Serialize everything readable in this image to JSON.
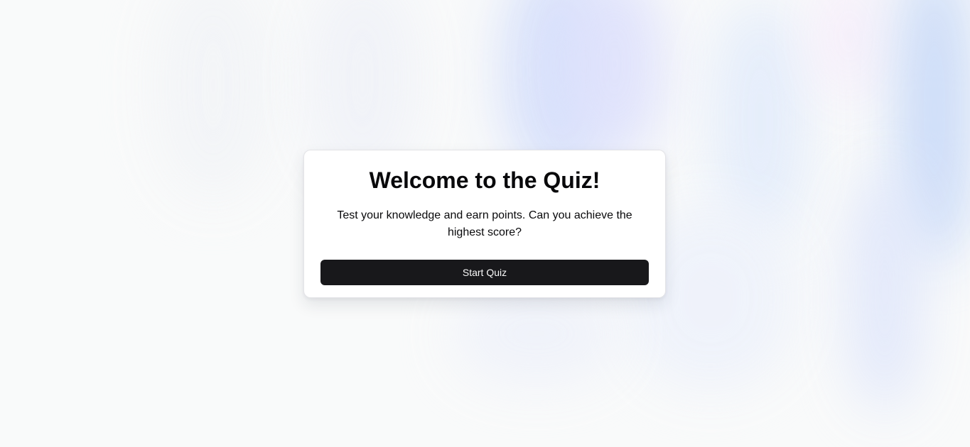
{
  "welcome": {
    "title": "Welcome to the Quiz!",
    "description": "Test your knowledge and earn points. Can you achieve the highest score?",
    "start_button_label": "Start Quiz"
  },
  "colors": {
    "background": "#f9fafa",
    "card": "#ffffff",
    "button": "#18181b",
    "button_text": "#fafafa",
    "text": "#09090b"
  }
}
